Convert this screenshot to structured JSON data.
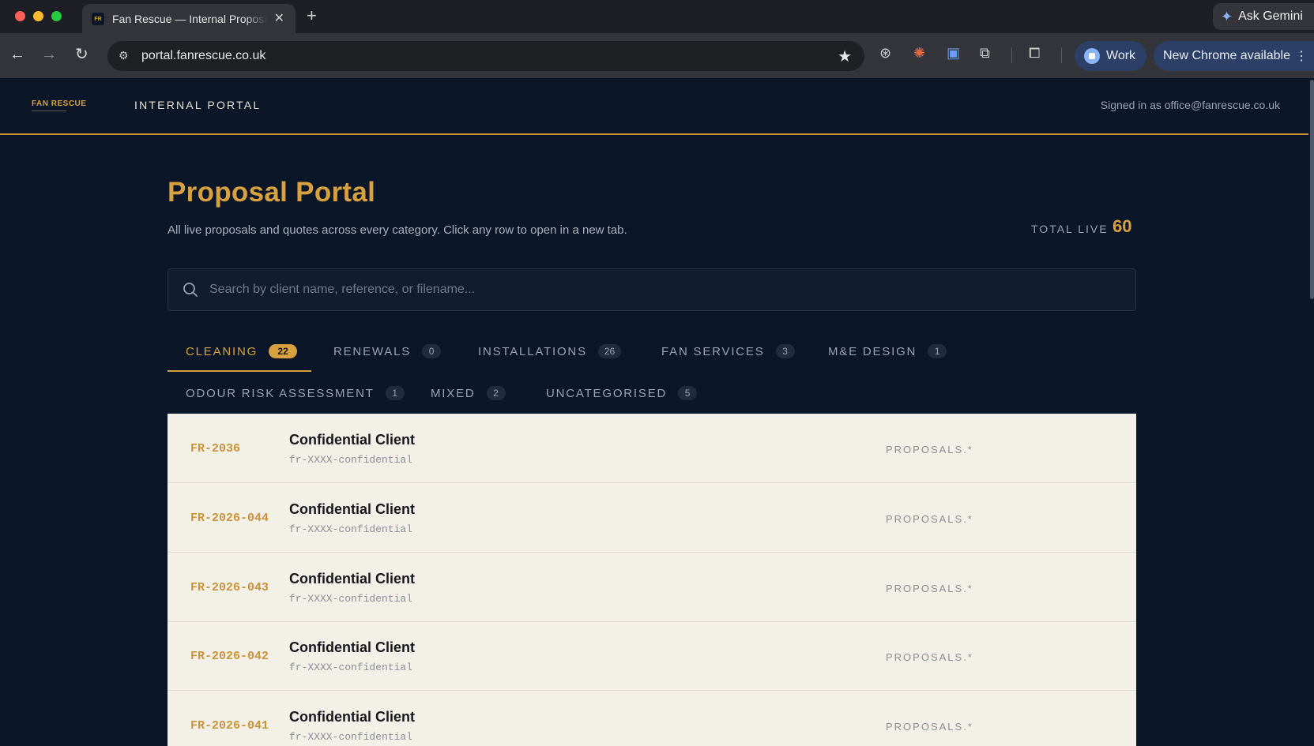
{
  "browser": {
    "tab_title": "Fan Rescue — Internal Proposals",
    "tab_favicon_text": "FR",
    "url": "portal.fanrescue.co.uk",
    "gemini_label": "Ask Gemini",
    "profile_label": "Work",
    "update_label": "New Chrome available"
  },
  "header": {
    "logo_text": "FAN RESCUE",
    "portal_label": "INTERNAL PORTAL",
    "signed_in": "Signed in as office@fanrescue.co.uk"
  },
  "main": {
    "title": "Proposal Portal",
    "subtitle": "All live proposals and quotes across every category. Click any row to open in a new tab.",
    "total_label": "TOTAL LIVE",
    "total_value": "60",
    "search_placeholder": "Search by client name, reference, or filename..."
  },
  "tabs": [
    {
      "label": "CLEANING",
      "count": "22",
      "active": true
    },
    {
      "label": "RENEWALS",
      "count": "0"
    },
    {
      "label": "INSTALLATIONS",
      "count": "26"
    },
    {
      "label": "FAN SERVICES",
      "count": "3"
    },
    {
      "label": "M&E DESIGN",
      "count": "1"
    },
    {
      "label": "ODOUR RISK ASSESSMENT",
      "count": "1"
    },
    {
      "label": "MIXED",
      "count": "2"
    },
    {
      "label": "UNCATEGORISED",
      "count": "5"
    }
  ],
  "rows": [
    {
      "ref": "FR-2036",
      "client": "Confidential Client",
      "file": "fr-XXXX-confidential",
      "type": "PROPOSALS.*"
    },
    {
      "ref": "FR-2026-044",
      "client": "Confidential Client",
      "file": "fr-XXXX-confidential",
      "type": "PROPOSALS.*"
    },
    {
      "ref": "FR-2026-043",
      "client": "Confidential Client",
      "file": "fr-XXXX-confidential",
      "type": "PROPOSALS.*"
    },
    {
      "ref": "FR-2026-042",
      "client": "Confidential Client",
      "file": "fr-XXXX-confidential",
      "type": "PROPOSALS.*"
    },
    {
      "ref": "FR-2026-041",
      "client": "Confidential Client",
      "file": "fr-XXXX-confidential",
      "type": "PROPOSALS.*"
    }
  ],
  "colors": {
    "page_bg": "#0b1628",
    "accent_gold": "#d8a13f",
    "row_bg": "#f3f0e8"
  }
}
